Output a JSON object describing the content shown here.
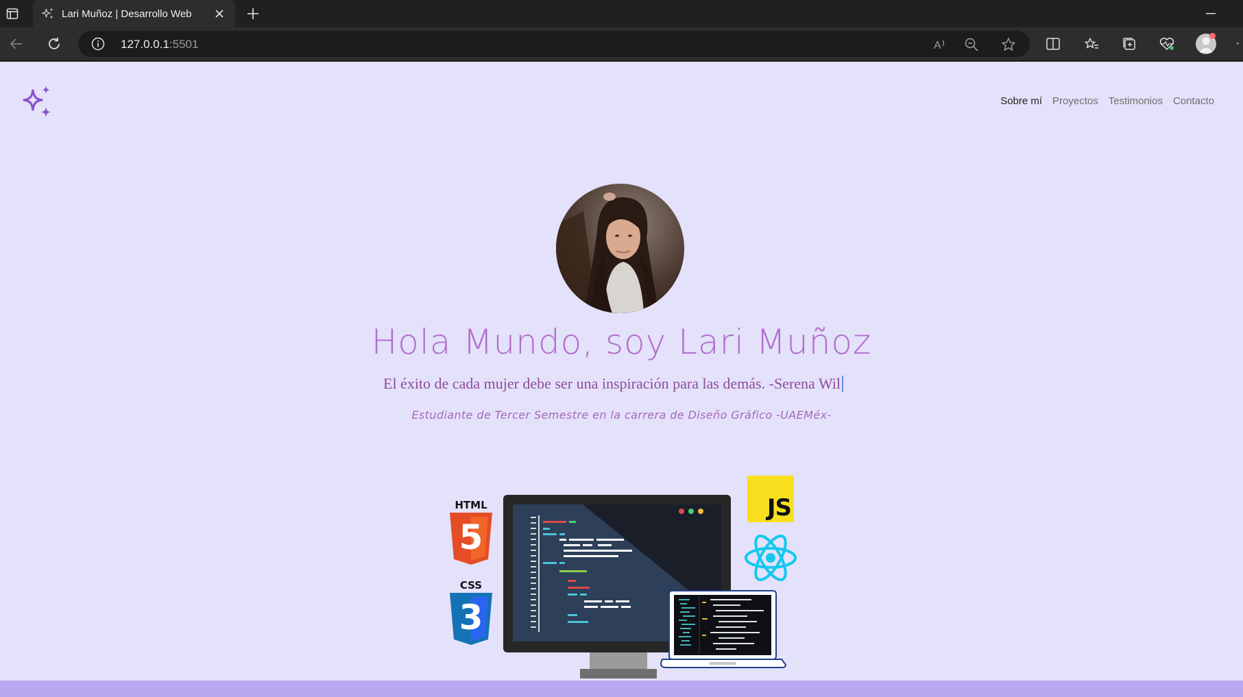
{
  "browser": {
    "tab_title": "Lari Muñoz | Desarrollo Web",
    "url_host": "127.0.0.1",
    "url_port": ":5501"
  },
  "site": {
    "nav": [
      "Sobre mí",
      "Proyectos",
      "Testimonios",
      "Contacto"
    ],
    "active_nav": "Sobre mí",
    "hero_title": "Hola Mundo, soy Lari Muñoz",
    "quote": "El éxito de cada mujer debe ser una inspiración para las demás. -Serena Wil",
    "subtitle": "Estudiante de Tercer Semestre en la carrera de Diseño Gráfico -UAEMéx-"
  },
  "illustration": {
    "html_label": "HTML",
    "html_number": "5",
    "css_label": "CSS",
    "css_number": "3",
    "js_label": "JS"
  },
  "colors": {
    "page_bg": "#e4e1fb",
    "accent": "#b06fc9",
    "footer": "#b9a8ef"
  }
}
